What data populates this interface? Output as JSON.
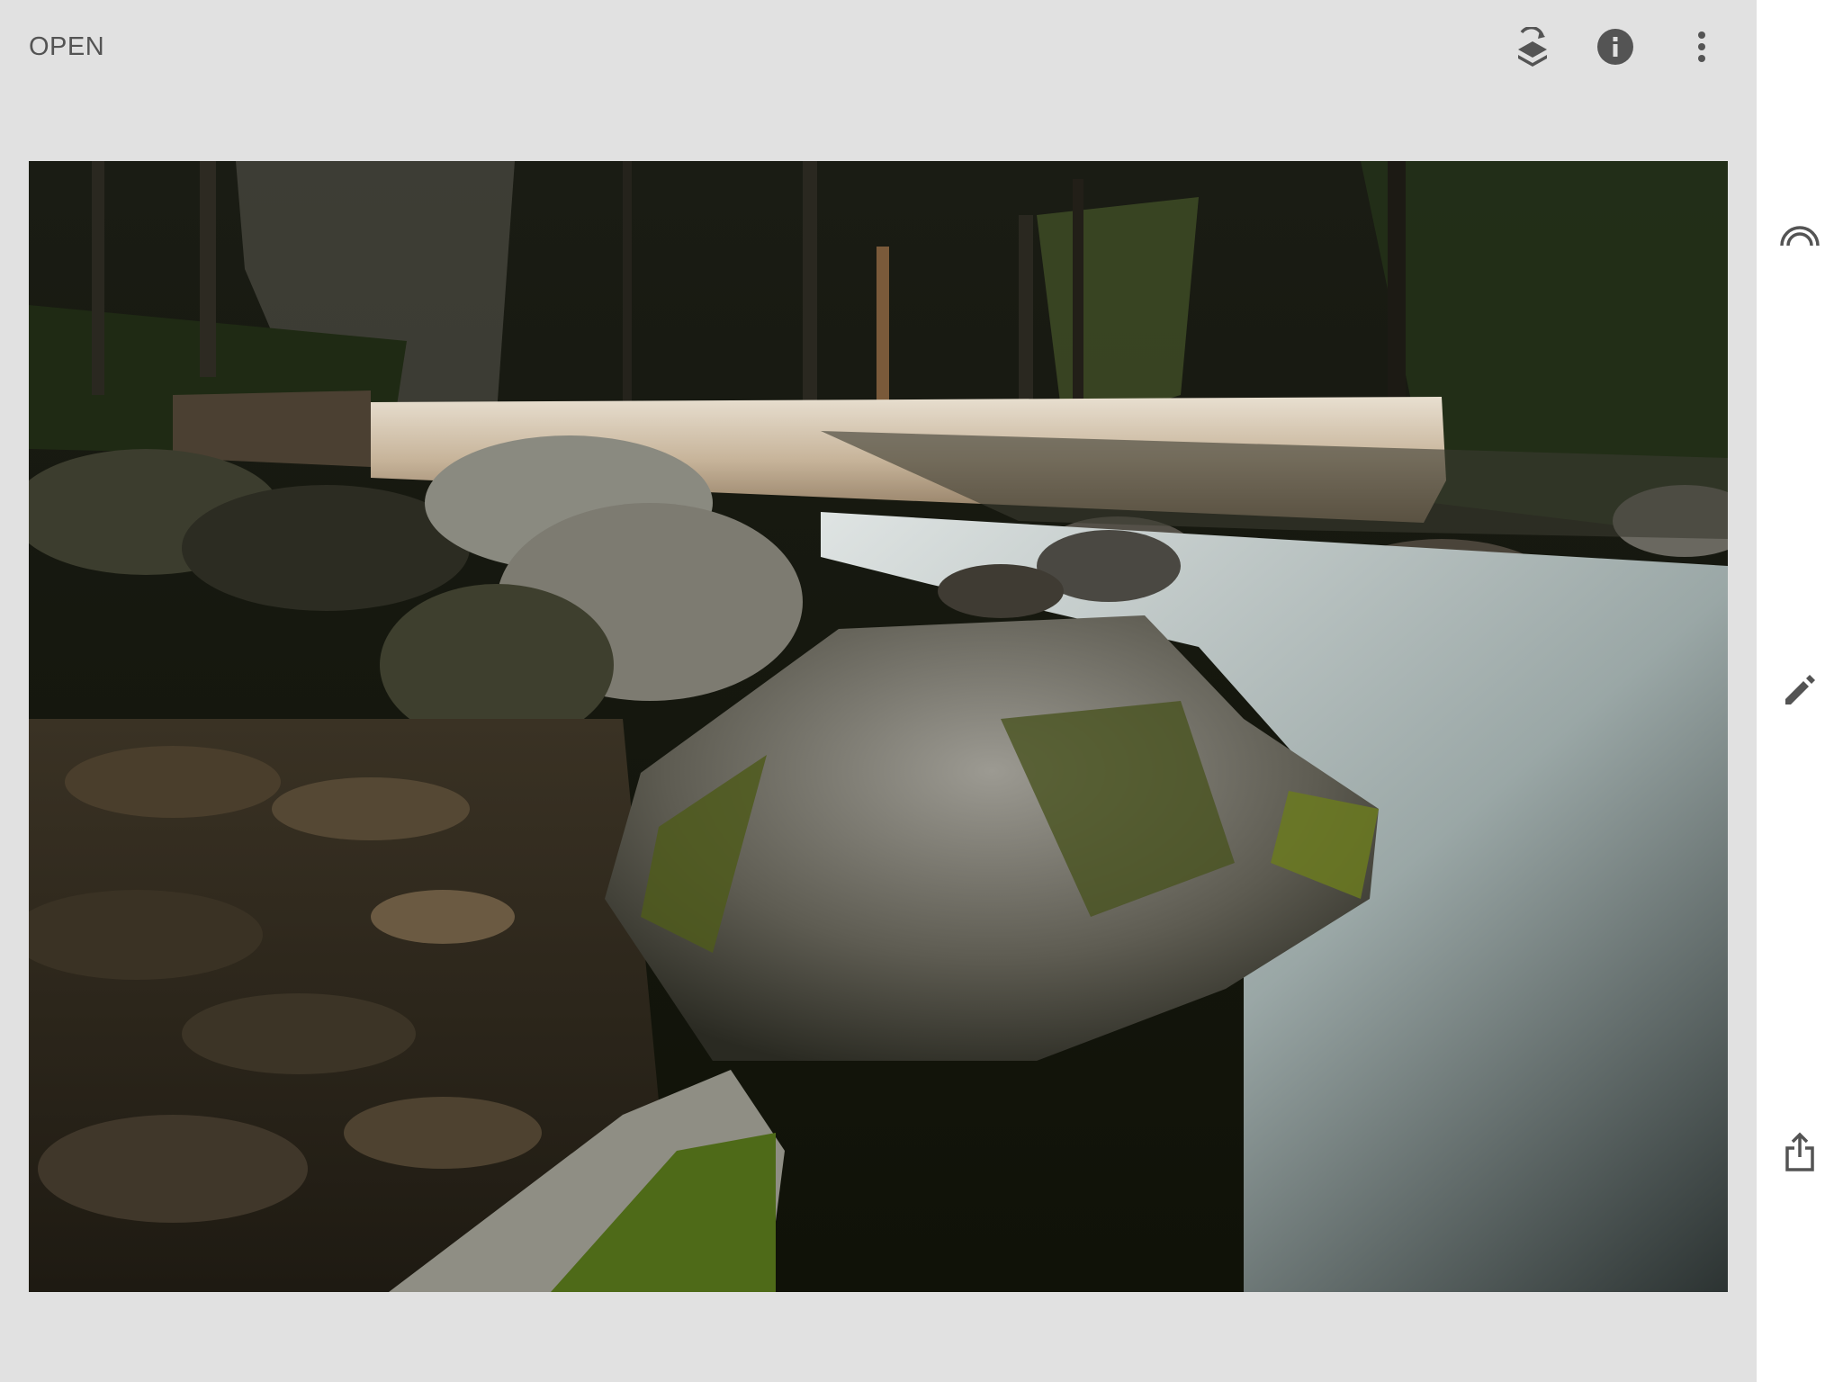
{
  "toolbar": {
    "open_label": "OPEN",
    "icons": [
      "layers-revert-icon",
      "info-icon",
      "more-vert-icon"
    ]
  },
  "photo": {
    "subject": "stream-photo"
  },
  "sidebar": {
    "icons": [
      "looks-icon",
      "tools-edit-icon",
      "export-share-icon"
    ]
  },
  "colors": {
    "background": "#e1e1e1",
    "sidebar": "#ffffff",
    "icon": "#545454",
    "text": "#545454"
  }
}
